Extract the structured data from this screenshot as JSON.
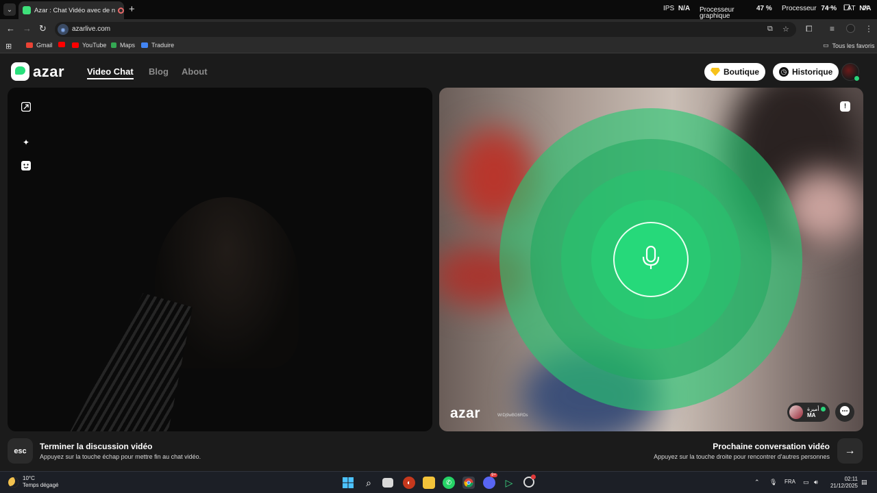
{
  "browser": {
    "tab_title": "Azar : Chat Vidéo avec de n",
    "url": "azarlive.com",
    "hud": {
      "ips_label": "IPS",
      "ips_value": "N/A",
      "gpu_label_1": "Processeur",
      "gpu_label_2": "graphique",
      "gpu_value": "47 %",
      "cpu_label": "Processeur",
      "cpu_value": "74 %",
      "lat_label": "LAT",
      "lat_value": "N/A"
    },
    "bookmarks": [
      {
        "label": "Gmail",
        "color": "#ea4335"
      },
      {
        "label": "",
        "color": "#ff0000"
      },
      {
        "label": "YouTube",
        "color": "#ff0000"
      },
      {
        "label": "Maps",
        "color": "#34a853"
      },
      {
        "label": "Traduire",
        "color": "#4285f4"
      }
    ],
    "bookmarks_all": "Tous les favoris"
  },
  "site": {
    "logo": "azar",
    "nav": [
      "Video Chat",
      "Blog",
      "About"
    ],
    "boutique": "Boutique",
    "historique": "Historique"
  },
  "remote": {
    "watermark": "azar",
    "watermark_id": "WrDj9wBG6RDs",
    "user_name": "أميرة",
    "user_country": "MA"
  },
  "footer": {
    "esc_key": "esc",
    "end_title": "Terminer la discussion vidéo",
    "end_sub": "Appuyez sur la touche échap pour mettre fin au chat vidéo.",
    "next_title": "Prochaine conversation vidéo",
    "next_sub": "Appuyez sur la touche droite pour rencontrer d'autres personnes"
  },
  "taskbar": {
    "temperature": "10°C",
    "weather": "Temps dégagé",
    "language": "FRA",
    "time": "02:11",
    "date": "21/12/2025",
    "discord_badge": "9+"
  },
  "colors": {
    "accent_green": "#26d97a",
    "page_bg": "#1b1b1b"
  }
}
